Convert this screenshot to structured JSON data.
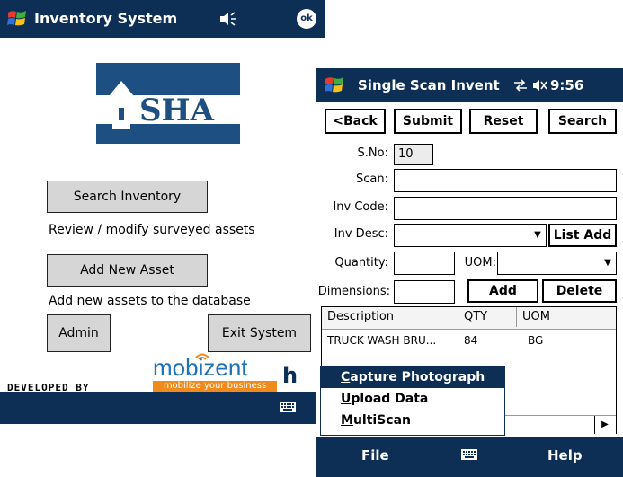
{
  "left_screen": {
    "title": "Inventory System",
    "ok_label": "ok",
    "logo_text": "SHA",
    "search_button": "Search Inventory",
    "search_desc": "Review / modify surveyed assets",
    "add_button": "Add New Asset",
    "add_desc": "Add new assets to the database",
    "admin_button": "Admin",
    "exit_button": "Exit System",
    "developed_by": "DEVELOPED BY",
    "brand": "mobizent",
    "brand_tagline": "mobilize your business",
    "brand_suffix": "h"
  },
  "right_screen": {
    "title": "Single Scan Invent",
    "time": "9:56",
    "toolbar": {
      "back": "<Back",
      "submit": "Submit",
      "reset": "Reset",
      "search": "Search"
    },
    "form": {
      "sno_label": "S.No:",
      "sno_value": "10",
      "scan_label": "Scan:",
      "scan_value": "",
      "invcode_label": "Inv Code:",
      "invcode_value": "",
      "invdesc_label": "Inv Desc:",
      "invdesc_value": "",
      "listadd_button": "List Add",
      "quantity_label": "Quantity:",
      "quantity_value": "",
      "uom_label": "UOM:",
      "uom_value": "",
      "dimensions_label": "Dimensions:",
      "dimensions_value": "",
      "add_button": "Add",
      "delete_button": "Delete"
    },
    "list": {
      "headers": [
        "Description",
        "QTY",
        "UOM"
      ],
      "rows": [
        {
          "description": "TRUCK WASH BRU...",
          "qty": "84",
          "uom": "BG"
        }
      ]
    },
    "menu": {
      "items": [
        {
          "label_first": "C",
          "label_rest": "apture Photograph"
        },
        {
          "label_first": "U",
          "label_rest": "pload Data"
        },
        {
          "label_first": "M",
          "label_rest": "ultiScan"
        }
      ]
    },
    "commands": {
      "left": "File",
      "right": "Help"
    }
  },
  "icons": {
    "windows_flag": "windows-start-icon",
    "speaker": "speaker-icon",
    "connectivity": "connectivity-icon",
    "keyboard": "keyboard-icon",
    "house": "house-logo-icon",
    "wifi": "wifi-icon"
  },
  "colors": {
    "titlebar": "#0d2f55",
    "logo_blue": "#1e4f82",
    "brand_blue": "#1d72b8",
    "brand_orange": "#f08a1c",
    "selection": "#0d2f55"
  }
}
